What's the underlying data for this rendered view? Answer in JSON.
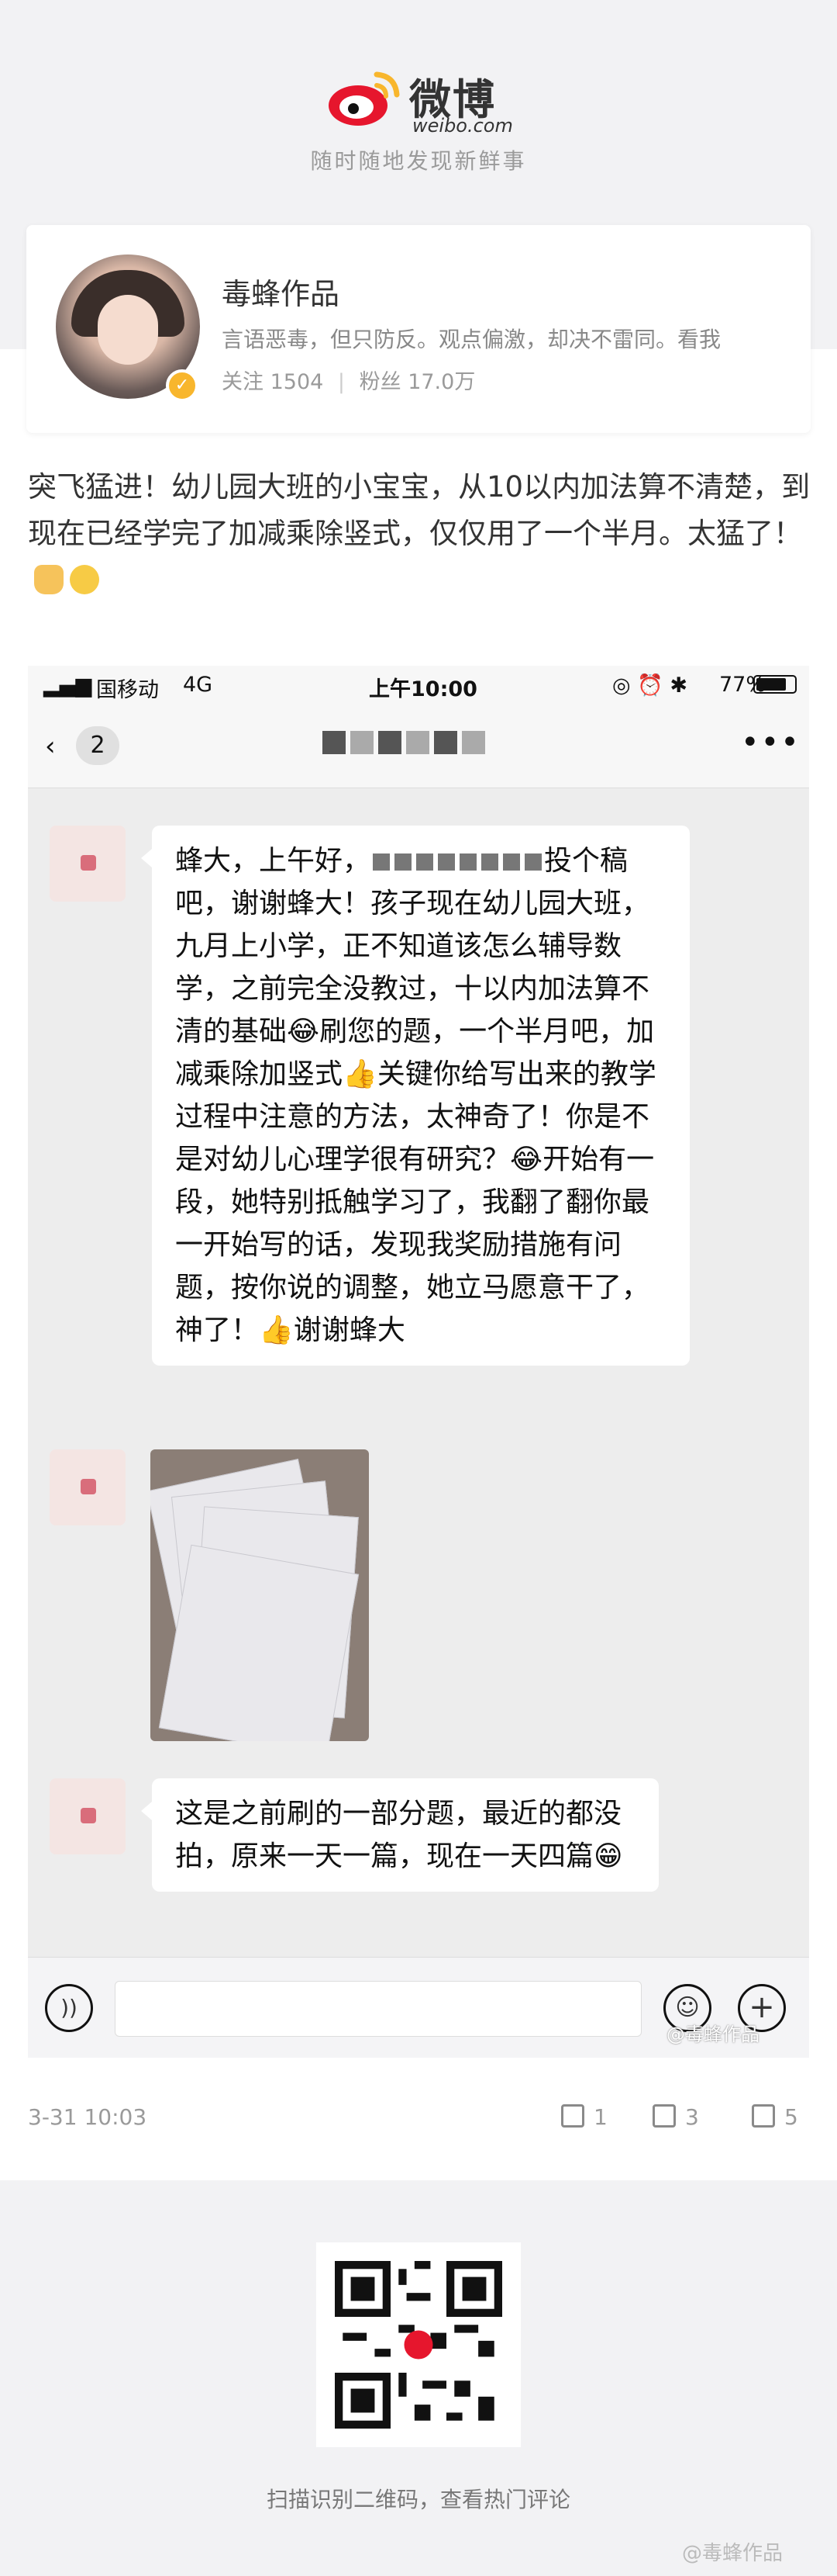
{
  "brand": {
    "logo_text": "微博",
    "logo_sub": "weibo.com",
    "tagline": "随时随地发现新鲜事"
  },
  "profile": {
    "name": "毒蜂作品",
    "bio": "言语恶毒，但只防反。观点偏激，却决不雷同。看我",
    "following_label": "关注",
    "following": "1504",
    "followers_label": "粉丝",
    "followers": "17.0万",
    "verified_color": "#f8b62d"
  },
  "post": {
    "text": "突飞猛进！幼儿园大班的小宝宝，从10以内加法算不清楚，到现在已经学完了加减乘除竖式，仅仅用了一个半月。太猛了！",
    "date": "3-31 10:03",
    "shares": "1",
    "comments": "3",
    "likes": "5"
  },
  "chat": {
    "status": {
      "carrier": "国移动",
      "network": "4G",
      "time": "上午10:00",
      "battery": "77%"
    },
    "nav": {
      "back": "‹",
      "unread": "2",
      "more": "•••"
    },
    "messages": [
      {
        "text_a": "蜂大，上午好，",
        "text_b": "投个稿吧，谢谢蜂大！孩子现在幼儿园大班，九月上小学，正不知道该怎么辅导数学，之前完全没教过，十以内加法算不清的基础😂刷您的题，一个半月吧，加减乘除加竖式👍关键你给写出来的教学过程中注意的方法，太神奇了！你是不是对幼儿心理学很有研究？😂开始有一段，她特别抵触学习了，我翻了翻你最一开始写的话，发现我奖励措施有问题，按你说的调整，她立马愿意干了，神了！👍谢谢蜂大"
      },
      {
        "text": "这是之前刷的一部分题，最近的都没拍，原来一天一篇，现在一天四篇😁"
      }
    ],
    "watermark": "@毒蜂作品"
  },
  "footer": {
    "qr_caption": "扫描识别二维码，查看热门评论",
    "watermark": "@毒蜂作品"
  },
  "colors": {
    "weibo_red": "#e6162d",
    "weibo_yellow": "#f8b62d"
  }
}
